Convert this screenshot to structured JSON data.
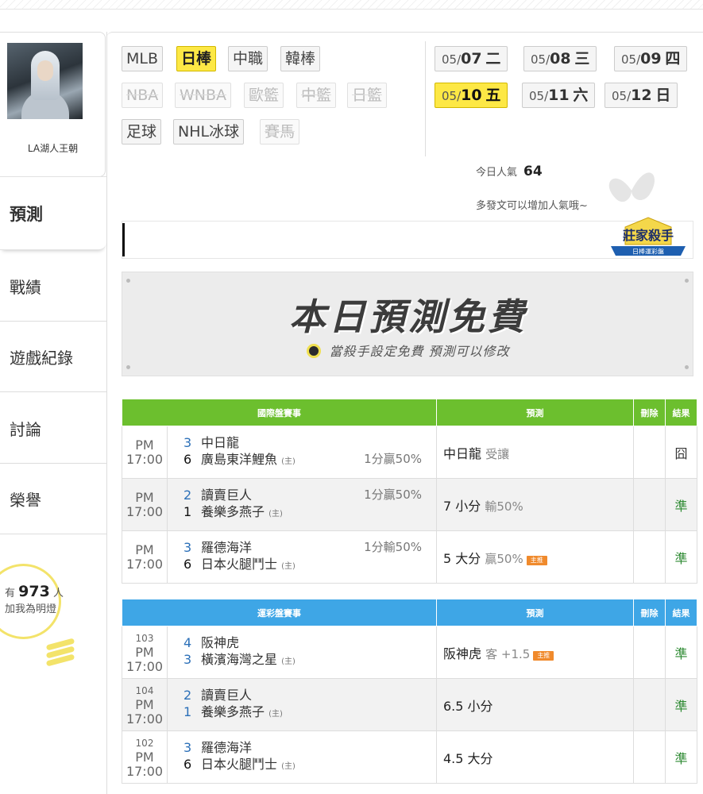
{
  "sidebar": {
    "username": "LA湖人王朝",
    "nav": [
      "預測",
      "戰績",
      "遊戲紀錄",
      "討論",
      "榮譽"
    ],
    "fans_prefix": "有",
    "fans_count": "973",
    "fans_suffix": "人",
    "fans_text": "加我為明燈"
  },
  "sports": {
    "row1": [
      "MLB",
      "日棒",
      "中職",
      "韓棒"
    ],
    "row2": [
      "NBA",
      "WNBA",
      "歐籃",
      "中籃",
      "日籃"
    ],
    "row3": [
      "足球",
      "NHL冰球",
      "賽馬"
    ],
    "active": "日棒"
  },
  "dates": [
    {
      "md": "05/",
      "day": "07",
      "wd": "二"
    },
    {
      "md": "05/",
      "day": "08",
      "wd": "三"
    },
    {
      "md": "05/",
      "day": "09",
      "wd": "四"
    },
    {
      "md": "05/",
      "day": "10",
      "wd": "五"
    },
    {
      "md": "05/",
      "day": "11",
      "wd": "六"
    },
    {
      "md": "05/",
      "day": "12",
      "wd": "日"
    }
  ],
  "popularity": {
    "label": "今日人氣",
    "value": "64",
    "hint": "多發文可以增加人氣哦~"
  },
  "badge": {
    "title": "莊家殺手",
    "sub": "日棒運彩盤"
  },
  "banner": {
    "title": "本日預測免費",
    "sub": "當殺手設定免費 預測可以修改"
  },
  "intl": {
    "headers": [
      "國際盤賽事",
      "預測",
      "刪除",
      "結果"
    ],
    "rows": [
      {
        "time": "PM 17:00",
        "n1": "3",
        "t1": "中日龍",
        "n2": "6",
        "t2": "廣島東洋鯉魚",
        "home": "(主)",
        "hcp": "1分贏50%",
        "hcp_row": 2,
        "pick": "中日龍",
        "pick_note": "受讓",
        "tag": "",
        "result": "囧"
      },
      {
        "time": "PM 17:00",
        "n1": "2",
        "t1": "讀賣巨人",
        "n2": "1",
        "t2": "養樂多燕子",
        "home": "(主)",
        "hcp": "1分贏50%",
        "hcp_row": 1,
        "pick": "7 小分",
        "pick_note": "輸50%",
        "tag": "",
        "result": "準"
      },
      {
        "time": "PM 17:00",
        "n1": "3",
        "t1": "羅德海洋",
        "n2": "6",
        "t2": "日本火腿鬥士",
        "home": "(主)",
        "hcp": "1分輸50%",
        "hcp_row": 1,
        "pick": "5 大分",
        "pick_note": "贏50%",
        "tag": "主推",
        "result": "準"
      }
    ]
  },
  "sport_lottery": {
    "headers": [
      "運彩盤賽事",
      "預測",
      "刪除",
      "結果"
    ],
    "rows": [
      {
        "id": "103",
        "time": "PM 17:00",
        "n1": "4",
        "t1": "阪神虎",
        "n2": "3",
        "t2": "橫濱海灣之星",
        "home": "(主)",
        "pick": "阪神虎",
        "pick_note": "客 +1.5",
        "tag": "主推",
        "result": "準"
      },
      {
        "id": "104",
        "time": "PM 17:00",
        "n1": "2",
        "t1": "讀賣巨人",
        "n2": "1",
        "t2": "養樂多燕子",
        "home": "(主)",
        "pick": "6.5 小分",
        "pick_note": "",
        "tag": "",
        "result": "準"
      },
      {
        "id": "102",
        "time": "PM 17:00",
        "n1": "3",
        "t1": "羅德海洋",
        "n2": "6",
        "t2": "日本火腿鬥士",
        "home": "(主)",
        "pick": "4.5 大分",
        "pick_note": "",
        "tag": "",
        "result": "準"
      }
    ]
  }
}
